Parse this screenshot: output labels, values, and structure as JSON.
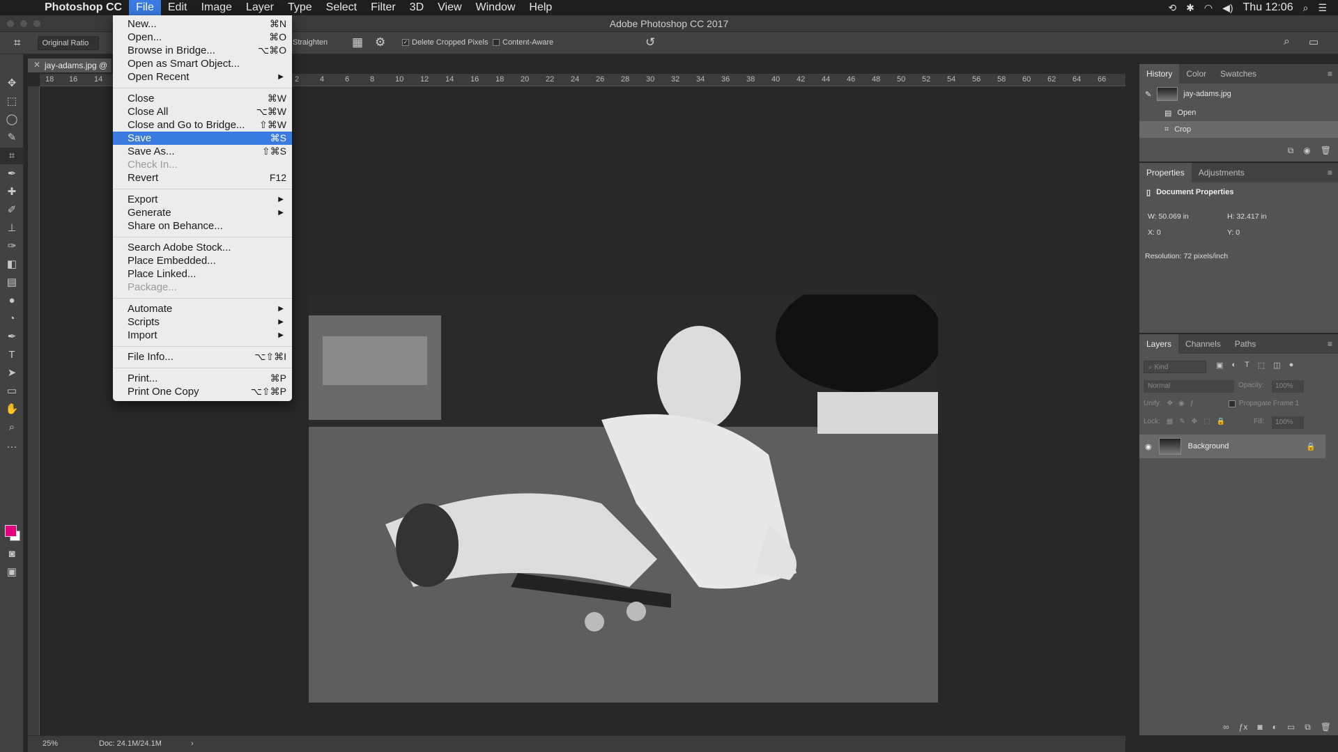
{
  "menubar": {
    "app": "Photoshop CC",
    "items": [
      "File",
      "Edit",
      "Image",
      "Layer",
      "Type",
      "Select",
      "Filter",
      "3D",
      "View",
      "Window",
      "Help"
    ],
    "time": "Thu 12:06"
  },
  "window": {
    "title": "Adobe Photoshop CC 2017"
  },
  "options": {
    "ratio": "Original Ratio",
    "straighten": "Straighten",
    "delete_cropped": "Delete Cropped Pixels",
    "content_aware": "Content-Aware"
  },
  "document": {
    "tab": "jay-adams.jpg @",
    "zoom": "25%",
    "doc_size": "Doc: 24.1M/24.1M",
    "ruler_top": [
      "18",
      "16",
      "14",
      "2",
      "4",
      "6",
      "8",
      "10",
      "12",
      "14",
      "16",
      "18",
      "20",
      "22",
      "24",
      "26",
      "28",
      "30",
      "32",
      "34",
      "36",
      "38",
      "40",
      "42",
      "44",
      "46",
      "48",
      "50",
      "52",
      "54",
      "56",
      "58",
      "60",
      "62",
      "64",
      "66"
    ]
  },
  "file_menu": {
    "items": [
      {
        "label": "New...",
        "shortcut": "⌘N"
      },
      {
        "label": "Open...",
        "shortcut": "⌘O"
      },
      {
        "label": "Browse in Bridge...",
        "shortcut": "⌥⌘O"
      },
      {
        "label": "Open as Smart Object...",
        "shortcut": ""
      },
      {
        "label": "Open Recent",
        "shortcut": "",
        "submenu": true
      },
      {
        "sep": true
      },
      {
        "label": "Close",
        "shortcut": "⌘W"
      },
      {
        "label": "Close All",
        "shortcut": "⌥⌘W"
      },
      {
        "label": "Close and Go to Bridge...",
        "shortcut": "⇧⌘W"
      },
      {
        "label": "Save",
        "shortcut": "⌘S",
        "highlight": true
      },
      {
        "label": "Save As...",
        "shortcut": "⇧⌘S"
      },
      {
        "label": "Check In...",
        "shortcut": "",
        "disabled": true
      },
      {
        "label": "Revert",
        "shortcut": "F12"
      },
      {
        "sep": true
      },
      {
        "label": "Export",
        "shortcut": "",
        "submenu": true
      },
      {
        "label": "Generate",
        "shortcut": "",
        "submenu": true
      },
      {
        "label": "Share on Behance...",
        "shortcut": ""
      },
      {
        "sep": true
      },
      {
        "label": "Search Adobe Stock...",
        "shortcut": ""
      },
      {
        "label": "Place Embedded...",
        "shortcut": ""
      },
      {
        "label": "Place Linked...",
        "shortcut": ""
      },
      {
        "label": "Package...",
        "shortcut": "",
        "disabled": true
      },
      {
        "sep": true
      },
      {
        "label": "Automate",
        "shortcut": "",
        "submenu": true
      },
      {
        "label": "Scripts",
        "shortcut": "",
        "submenu": true
      },
      {
        "label": "Import",
        "shortcut": "",
        "submenu": true
      },
      {
        "sep": true
      },
      {
        "label": "File Info...",
        "shortcut": "⌥⇧⌘I"
      },
      {
        "sep": true
      },
      {
        "label": "Print...",
        "shortcut": "⌘P"
      },
      {
        "label": "Print One Copy",
        "shortcut": "⌥⇧⌘P"
      }
    ]
  },
  "history": {
    "tabs": [
      "History",
      "Color",
      "Swatches"
    ],
    "snapshot": "jay-adams.jpg",
    "states": [
      "Open",
      "Crop"
    ]
  },
  "properties": {
    "tabs": [
      "Properties",
      "Adjustments"
    ],
    "heading": "Document Properties",
    "w": "W:  50.069 in",
    "h": "H:  32.417 in",
    "x": "X:  0",
    "y": "Y:  0",
    "resolution": "Resolution: 72 pixels/inch"
  },
  "layers": {
    "tabs": [
      "Layers",
      "Channels",
      "Paths"
    ],
    "kind": "Kind",
    "blend": "Normal",
    "opacity_label": "Opacity:",
    "opacity": "100%",
    "unify": "Unify:",
    "propagate": "Propagate Frame 1",
    "lock": "Lock:",
    "fill_label": "Fill:",
    "fill": "100%",
    "layer_name": "Background"
  },
  "colors": {
    "foreground": "#e6007e",
    "background": "#ffffff",
    "accent": "#3a7be2"
  }
}
